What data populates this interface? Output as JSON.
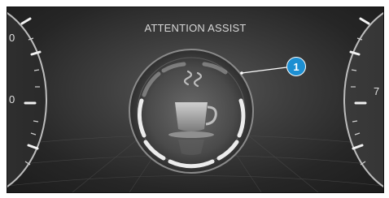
{
  "display": {
    "title": "ATTENTION ASSIST",
    "callout_label": "1",
    "center_icon": "coffee-cup-icon"
  },
  "left_gauge": {
    "partial_labels": [
      "0",
      "0"
    ]
  },
  "right_gauge": {
    "partial_labels": [
      "7"
    ]
  },
  "colors": {
    "callout": "#1d8fd2",
    "ring": "#e8e8e8",
    "background": "#2b2b2b"
  }
}
